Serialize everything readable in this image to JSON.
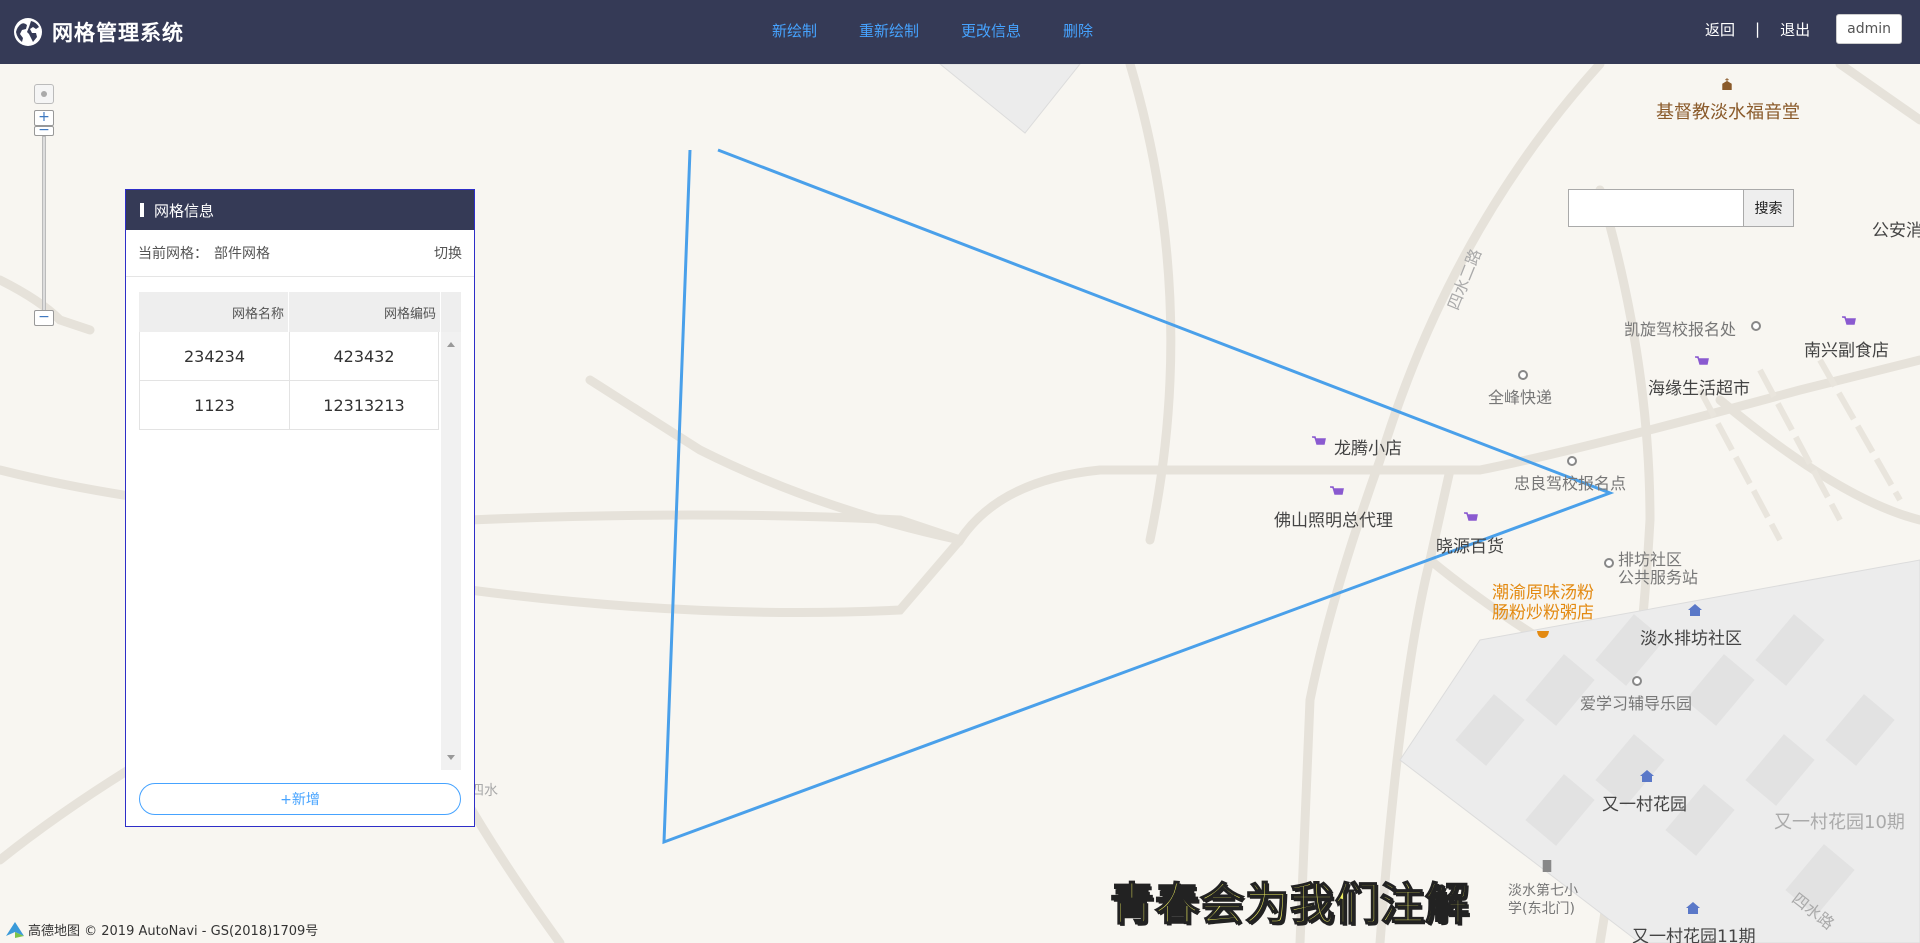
{
  "app": {
    "title": "网格管理系统",
    "logo_icon": "globe-icon"
  },
  "nav": {
    "items": [
      {
        "label": "新绘制"
      },
      {
        "label": "重新绘制"
      },
      {
        "label": "更改信息"
      },
      {
        "label": "删除"
      }
    ],
    "color": "#46a3ff"
  },
  "header_actions": {
    "back": "返回",
    "separator": "|",
    "logout": "退出",
    "user": "admin"
  },
  "search": {
    "button": "搜索",
    "value": ""
  },
  "panel": {
    "title": "网格信息",
    "current_label": "当前网格：",
    "current_value": "部件网格",
    "switch": "切换",
    "columns": [
      "网格名称",
      "网格编码"
    ],
    "rows": [
      [
        "234234",
        "423432"
      ],
      [
        "1123",
        "12313213"
      ]
    ],
    "add_button": "+新增"
  },
  "map": {
    "pois": {
      "church": "基督教淡水福音堂",
      "police": "公安消",
      "road_siwu": "四水二路",
      "kaixuan": "凯旋驾校报名处",
      "nanxing": "南兴副食店",
      "haiyuan": "海缘生活超市",
      "quanfeng": "全峰快递",
      "longteng": "龙腾小店",
      "zhongliang": "忠良驾校报名点",
      "foshan": "佛山照明总代理",
      "xiaoyuan": "晓源百货",
      "paifang_1": "排坊社区",
      "paifang_2": "公共服务站",
      "chaoyu_1": "潮渝原味汤粉",
      "chaoyu_2": "肠粉炒粉粥店",
      "danshui_paifang": "淡水排坊社区",
      "aixuexi": "爱学习辅导乐园",
      "youyicun": "又一村花园",
      "youyicun10": "又一村花园10期",
      "school_1": "淡水第七小",
      "school_2": "学(东北门)",
      "youyicun11": "又一村花园11期",
      "road_sishui": "四水路",
      "siwu_left": "四水"
    },
    "polygon_color": "#4aa0ea",
    "attribution": "高德地图 © 2019 AutoNavi - GS(2018)1709号"
  },
  "overlay_caption": "青春会为我们注解"
}
